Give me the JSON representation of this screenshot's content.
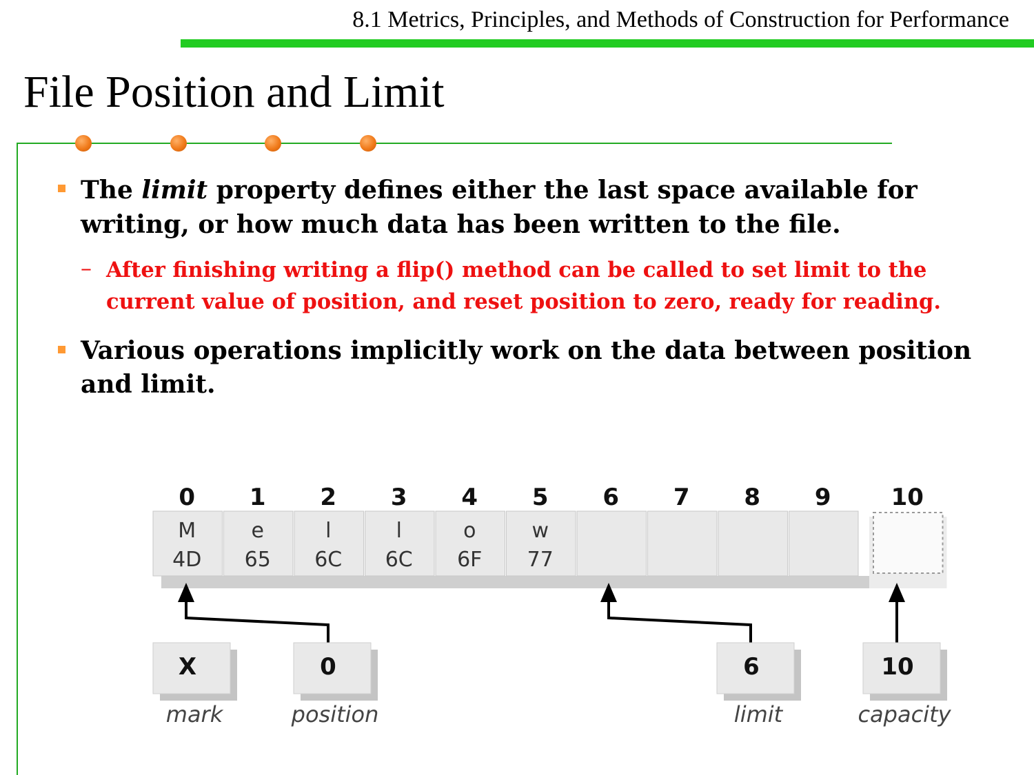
{
  "header": {
    "section_title": "8.1 Metrics, Principles, and Methods of Construction for Performance"
  },
  "slide": {
    "title": "File Position and Limit"
  },
  "bullets": [
    {
      "prefix": "The ",
      "italic": "limit",
      "line1_rest": " property defines either the last space available for",
      "line2": "writing, or how much data has been written to the file."
    },
    {
      "line1": "Various operations implicitly work on the data between position",
      "line2": "and limit."
    }
  ],
  "sub_bullet": {
    "dash": "–",
    "line1": "After finishing writing a flip() method can be called to set limit to the",
    "line2": "current value of position, and reset position to zero, ready for reading."
  },
  "diagram": {
    "indices": [
      "0",
      "1",
      "2",
      "3",
      "4",
      "5",
      "6",
      "7",
      "8",
      "9",
      "10"
    ],
    "cells": [
      {
        "char": "M",
        "hex": "4D"
      },
      {
        "char": "e",
        "hex": "65"
      },
      {
        "char": "l",
        "hex": "6C"
      },
      {
        "char": "l",
        "hex": "6C"
      },
      {
        "char": "o",
        "hex": "6F"
      },
      {
        "char": "w",
        "hex": "77"
      },
      {
        "char": "",
        "hex": ""
      },
      {
        "char": "",
        "hex": ""
      },
      {
        "char": "",
        "hex": ""
      },
      {
        "char": "",
        "hex": ""
      }
    ],
    "markers": [
      {
        "value": "X",
        "label": "mark"
      },
      {
        "value": "0",
        "label": "position"
      },
      {
        "value": "6",
        "label": "limit"
      },
      {
        "value": "10",
        "label": "capacity"
      }
    ]
  },
  "colors": {
    "accent_green": "#22cc22",
    "frame_green": "#22aa22",
    "bullet_orange": "#ff9933",
    "sub_red": "#ee1111",
    "dot_orange": "#f07a1a"
  }
}
